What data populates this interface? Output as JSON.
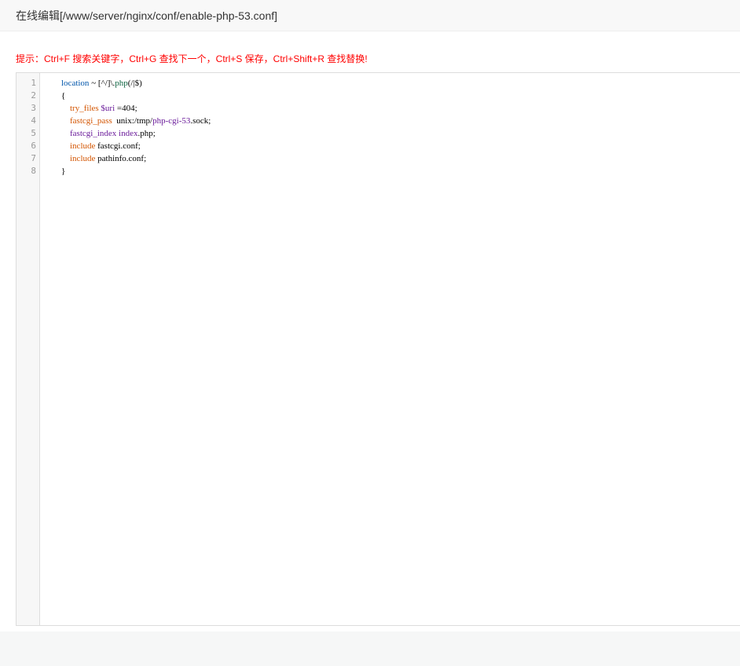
{
  "header": {
    "title": "在线编辑[/www/server/nginx/conf/enable-php-53.conf]"
  },
  "hint": {
    "text": "提示：Ctrl+F 搜索关键字，Ctrl+G 查找下一个，Ctrl+S 保存，Ctrl+Shift+R 查找替换!"
  },
  "editor": {
    "line_numbers": [
      "1",
      "2",
      "3",
      "4",
      "5",
      "6",
      "7",
      "8"
    ],
    "lines": [
      {
        "indent": "        ",
        "tokens": [
          {
            "text": "location",
            "color": "#05a"
          },
          {
            "text": " ~ [",
            "color": "#000000"
          },
          {
            "text": "^",
            "color": "#000000"
          },
          {
            "text": "/]\\.",
            "color": "#000000"
          },
          {
            "text": "php",
            "color": "#116644"
          },
          {
            "text": "(/|$)",
            "color": "#000000"
          }
        ]
      },
      {
        "indent": "        ",
        "tokens": [
          {
            "text": "{",
            "color": "#000000"
          }
        ]
      },
      {
        "indent": "            ",
        "tokens": [
          {
            "text": "try_files",
            "color": "#d35400"
          },
          {
            "text": " ",
            "color": "#000000"
          },
          {
            "text": "$uri",
            "color": "#6a1b9a"
          },
          {
            "text": " =404;",
            "color": "#000000"
          }
        ]
      },
      {
        "indent": "            ",
        "tokens": [
          {
            "text": "fastcgi_pass",
            "color": "#d35400"
          },
          {
            "text": "  unix:/tmp/",
            "color": "#000000"
          },
          {
            "text": "php-cgi-53",
            "color": "#6a1b9a"
          },
          {
            "text": ".sock;",
            "color": "#000000"
          }
        ]
      },
      {
        "indent": "            ",
        "tokens": [
          {
            "text": "fastcgi_index",
            "color": "#6a1b9a"
          },
          {
            "text": " ",
            "color": "#000000"
          },
          {
            "text": "index",
            "color": "#6a1b9a"
          },
          {
            "text": ".php;",
            "color": "#000000"
          }
        ]
      },
      {
        "indent": "            ",
        "tokens": [
          {
            "text": "include",
            "color": "#d35400"
          },
          {
            "text": " fastcgi.conf;",
            "color": "#000000"
          }
        ]
      },
      {
        "indent": "            ",
        "tokens": [
          {
            "text": "include",
            "color": "#d35400"
          },
          {
            "text": " pathinfo.conf;",
            "color": "#000000"
          }
        ]
      },
      {
        "indent": "        ",
        "tokens": [
          {
            "text": "}",
            "color": "#000000"
          }
        ]
      }
    ]
  }
}
